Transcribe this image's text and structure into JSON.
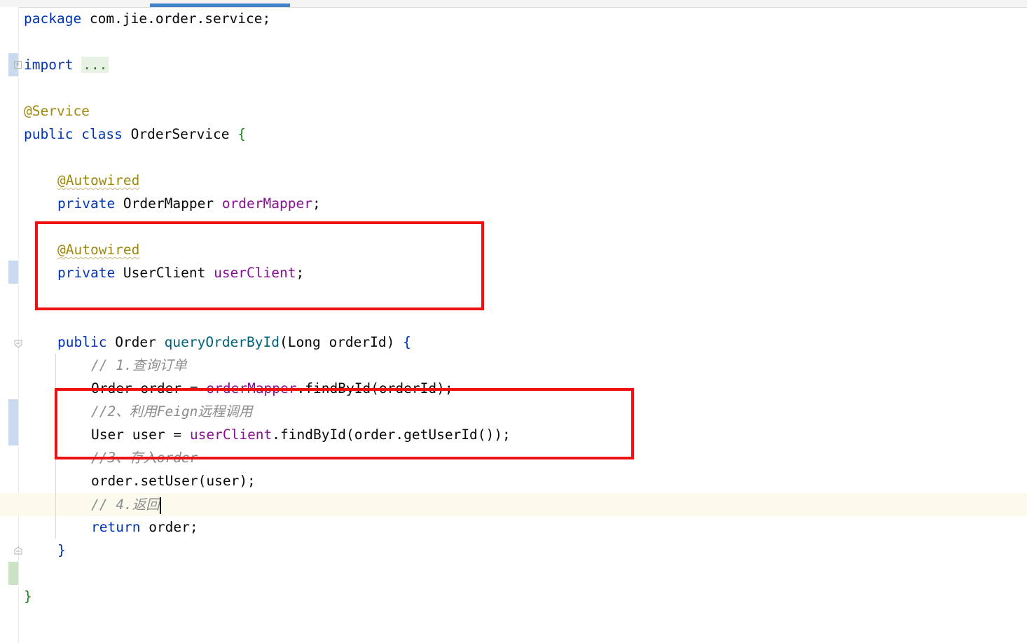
{
  "editor": {
    "lines": {
      "l1_pkg_kw": "package",
      "l1_pkg_name": " com.jie.order.service;",
      "l2_import_kw": "import",
      "l2_import_fold": "...",
      "l3_ann": "@Service",
      "l4_public": "public",
      "l4_class": "class",
      "l4_name": " OrderService ",
      "l4_brace": "{",
      "l5_ann": "@Autowired",
      "l6_private": "private",
      "l6_type": " OrderMapper ",
      "l6_field": "orderMapper",
      "l6_end": ";",
      "l7_ann": "@Autowired",
      "l8_private": "private",
      "l8_type": " UserClient ",
      "l8_field": "userClient",
      "l8_end": ";",
      "l9_public": "public",
      "l9_type": " Order ",
      "l9_method": "queryOrderById",
      "l9_params": "(Long orderId) ",
      "l9_brace": "{",
      "l10_comment": "// 1.查询订单",
      "l11_a": "Order order = ",
      "l11_field": "orderMapper",
      "l11_b": ".findById(orderId);",
      "l12_comment": "//2、利用Feign远程调用",
      "l13_a": "User user = ",
      "l13_field": "userClient",
      "l13_b": ".findById(order.getUserId());",
      "l14_comment": "//3、存入order",
      "l15_code": "order.setUser(user);",
      "l16_comment": "// 4.返回",
      "l17_return": "return",
      "l17_rest": " order;",
      "l18_brace": "}",
      "l19_brace": "}"
    }
  },
  "colors": {
    "keyword": "#0033b3",
    "annotation": "#9e880d",
    "field": "#871094",
    "method": "#00627a",
    "comment": "#8c8c8c",
    "highlight_box": "#ee1111",
    "caret_line": "#fcfaed"
  },
  "icons": {
    "import_fold": "fold-plus-icon",
    "method_fold_start": "fold-open-icon",
    "method_fold_end": "fold-close-icon"
  }
}
